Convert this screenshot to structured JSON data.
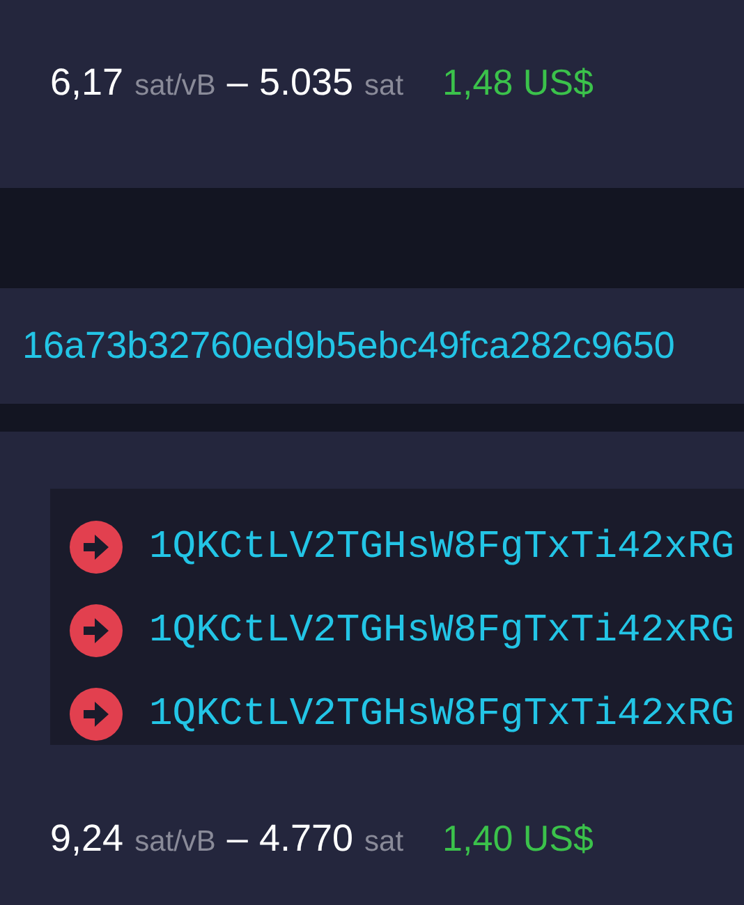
{
  "fees": [
    {
      "rate": "6,17",
      "rate_unit": "sat/vB",
      "separator": "–",
      "amount": "5.035",
      "amount_unit": "sat",
      "fiat": "1,48 US$"
    },
    {
      "rate": "9,24",
      "rate_unit": "sat/vB",
      "separator": "–",
      "amount": "4.770",
      "amount_unit": "sat",
      "fiat": "1,40 US$"
    }
  ],
  "txid": "16a73b32760ed9b5ebc49fca282c9650",
  "inputs": [
    {
      "address": "1QKCtLV2TGHsW8FgTxTi42xRG"
    },
    {
      "address": "1QKCtLV2TGHsW8FgTxTi42xRG"
    },
    {
      "address": "1QKCtLV2TGHsW8FgTxTi42xRG"
    }
  ]
}
